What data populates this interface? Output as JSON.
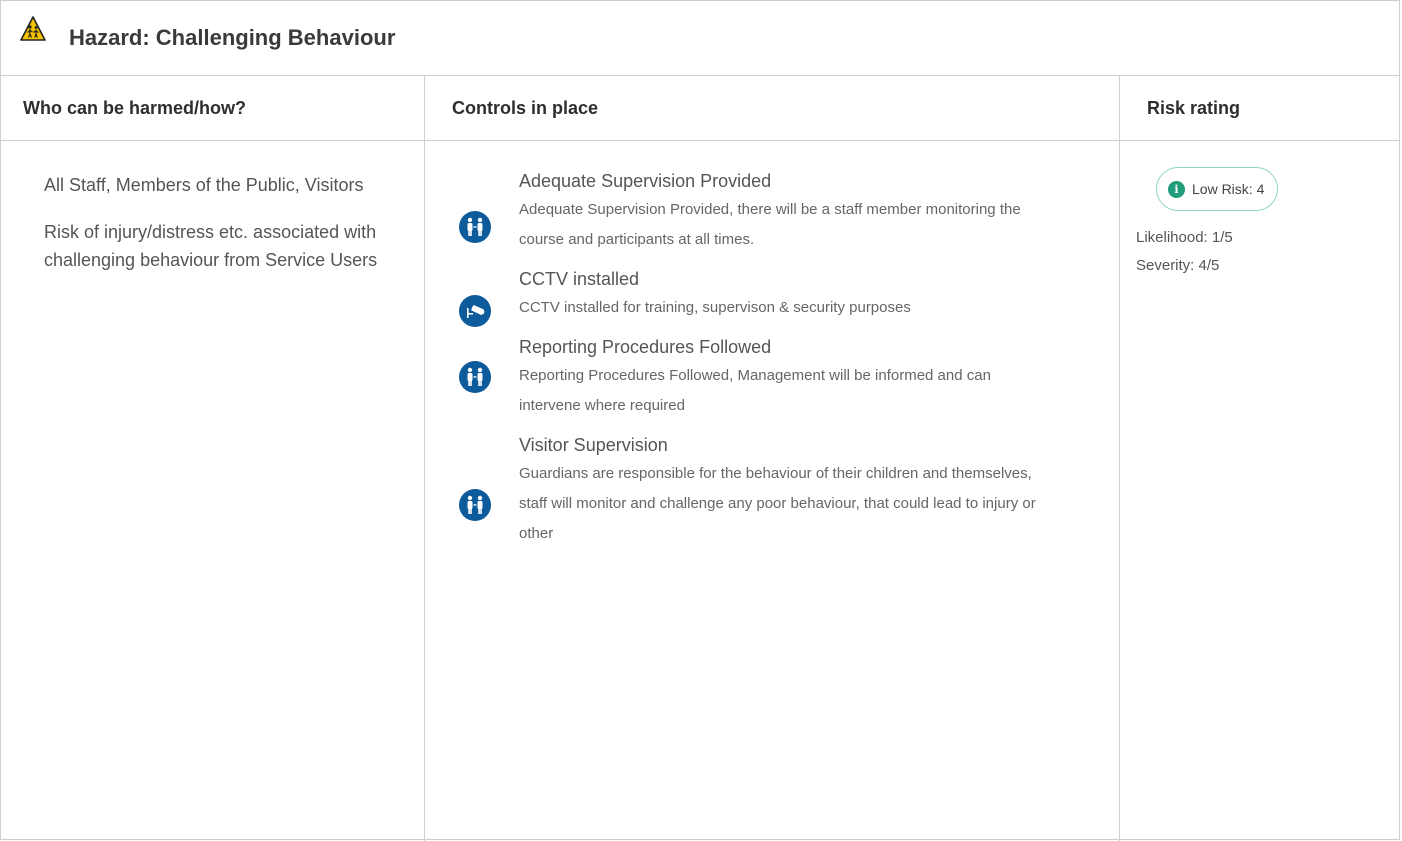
{
  "hazard": {
    "title": "Hazard:  Challenging Behaviour",
    "icon": "warning-children-icon"
  },
  "columns": {
    "who": "Who can be harmed/how?",
    "controls": "Controls in place",
    "risk": "Risk rating"
  },
  "who": {
    "people": "All Staff, Members of the Public, Visitors",
    "how": "Risk of injury/distress etc. associated with challenging behaviour from Service Users"
  },
  "controls": [
    {
      "title": "Adequate Supervision Provided",
      "description": "Adequate Supervision Provided, there will be a staff member monitoring the course and participants at all times.",
      "icon": "supervision-icon"
    },
    {
      "title": "CCTV installed",
      "description": "CCTV installed for training, supervison & security purposes",
      "icon": "cctv-icon"
    },
    {
      "title": "Reporting Procedures Followed",
      "description": "Reporting Procedures Followed, Management will be informed and can intervene where required",
      "icon": "supervision-icon"
    },
    {
      "title": "Visitor Supervision",
      "description": "Guardians are responsible for the behaviour of their children and themselves, staff will monitor and challenge any poor behaviour, that could lead to injury or other",
      "icon": "supervision-icon"
    }
  ],
  "risk": {
    "badge": "Low Risk: 4",
    "likelihood": "Likelihood: 1/5",
    "severity": "Severity: 4/5",
    "color": "#1f9c7a"
  }
}
